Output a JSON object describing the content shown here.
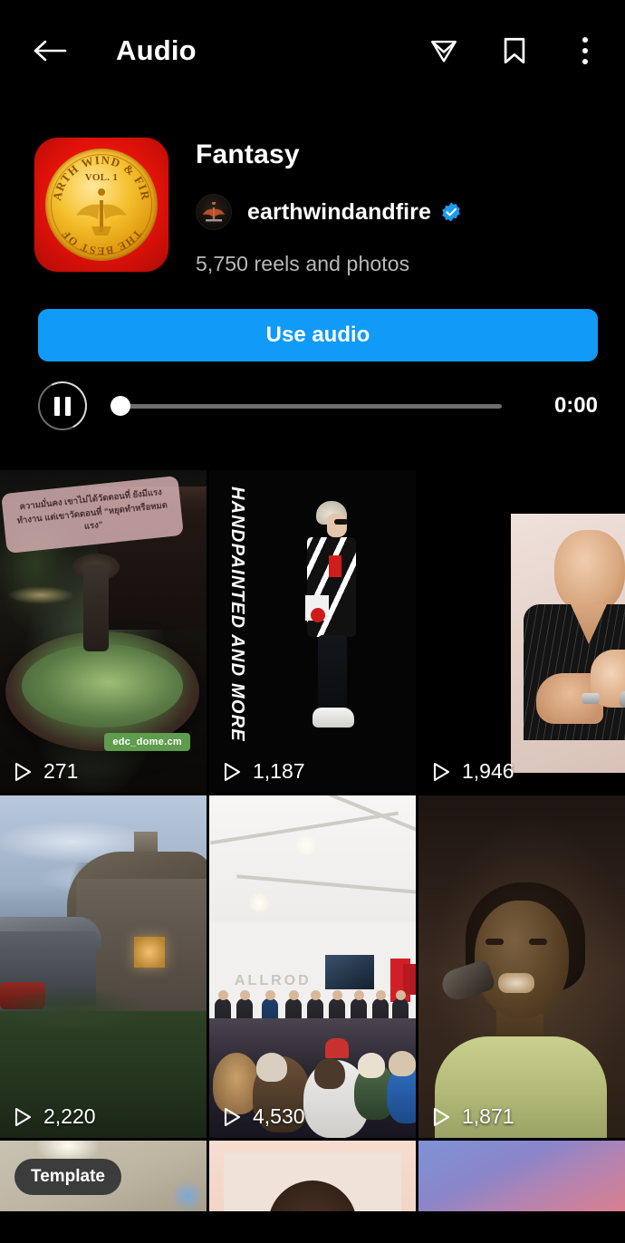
{
  "header": {
    "title": "Audio",
    "back_icon": "arrow-left-icon",
    "share_icon": "paper-plane-icon",
    "save_icon": "bookmark-icon",
    "menu_icon": "three-dots-vertical-icon"
  },
  "audio": {
    "track_title": "Fantasy",
    "artist_name": "earthwindandfire",
    "verified": true,
    "reel_count": "5,750 reels and photos",
    "album_art": {
      "arc_top": "EARTH WIND & FIRE",
      "arc_bottom": "THE BEST OF",
      "center": "VOL. 1",
      "bg_color": "#e2120a",
      "coin_color": "#f5c02e"
    },
    "use_audio_label": "Use audio",
    "use_audio_color": "#0F9BF7",
    "player": {
      "state_icon": "pause-icon",
      "progress_percent": 0,
      "time": "0:00"
    }
  },
  "grid": {
    "items": [
      {
        "id": "reel-1",
        "views": "271",
        "play_icon": "play-triangle-icon",
        "overlay_text": "ความมั่นคง เขาไม่ได้วัดตอนที่ ยังมีแรงทำงาน แต่เขาวัดตอนที่ “หยุดทำหรือหมดแรง”",
        "watermark": "edc_dome.cm",
        "description": "night-fountain-garden"
      },
      {
        "id": "reel-2",
        "views": "1,187",
        "play_icon": "play-triangle-icon",
        "overlay_text": "HANDPAINTED AND MORE",
        "description": "person-in-painted-jacket-black-bg"
      },
      {
        "id": "reel-3",
        "views": "1,946",
        "play_icon": "play-triangle-icon",
        "description": "bald-man-pinstripe-shirt-clapping"
      },
      {
        "id": "reel-4",
        "views": "2,220",
        "play_icon": "play-triangle-icon",
        "description": "thatched-cottage-at-dusk"
      },
      {
        "id": "reel-5",
        "views": "4,530",
        "play_icon": "play-triangle-icon",
        "description": "gallery-event-audience"
      },
      {
        "id": "reel-6",
        "views": "1,871",
        "play_icon": "play-triangle-icon",
        "description": "vintage-singer-with-microphone"
      },
      {
        "id": "reel-7",
        "badge": "Template",
        "description": "beige-interior-partial"
      },
      {
        "id": "reel-8",
        "description": "peach-background-person-partial"
      },
      {
        "id": "reel-9",
        "description": "blue-pink-gradient-partial"
      }
    ]
  }
}
